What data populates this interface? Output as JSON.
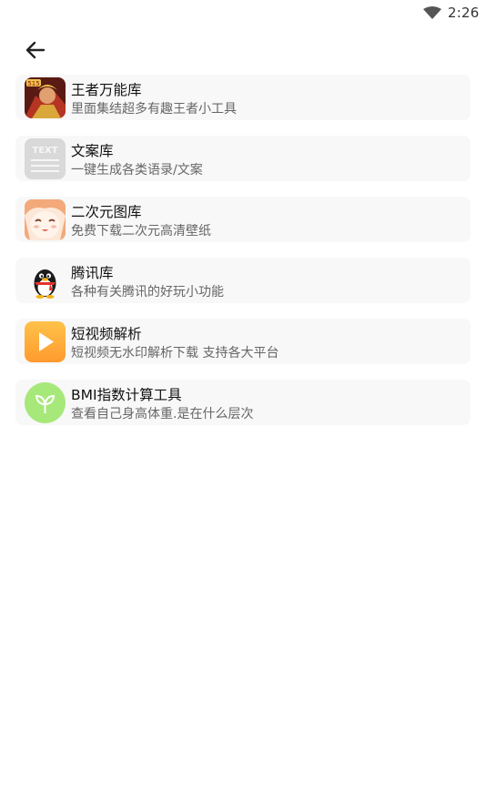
{
  "status_bar": {
    "time": "2:26",
    "wifi_icon": "wifi-icon"
  },
  "header": {
    "back_icon": "arrow-left-icon"
  },
  "tools": [
    {
      "title": "王者万能库",
      "desc": "里面集结超多有趣王者小工具",
      "icon": "game-hero-icon"
    },
    {
      "title": "文案库",
      "desc": "一键生成各类语录/文案",
      "icon": "text-doc-icon",
      "icon_text": "TEXT"
    },
    {
      "title": "二次元图库",
      "desc": "免费下载二次元高清壁纸",
      "icon": "anime-girl-icon"
    },
    {
      "title": "腾讯库",
      "desc": "各种有关腾讯的好玩小功能",
      "icon": "penguin-icon"
    },
    {
      "title": "短视频解析",
      "desc": "短视频无水印解析下载 支持各大平台",
      "icon": "play-icon"
    },
    {
      "title": "BMI指数计算工具",
      "desc": "查看自己身高体重.是在什么层次",
      "icon": "sprout-icon"
    }
  ]
}
